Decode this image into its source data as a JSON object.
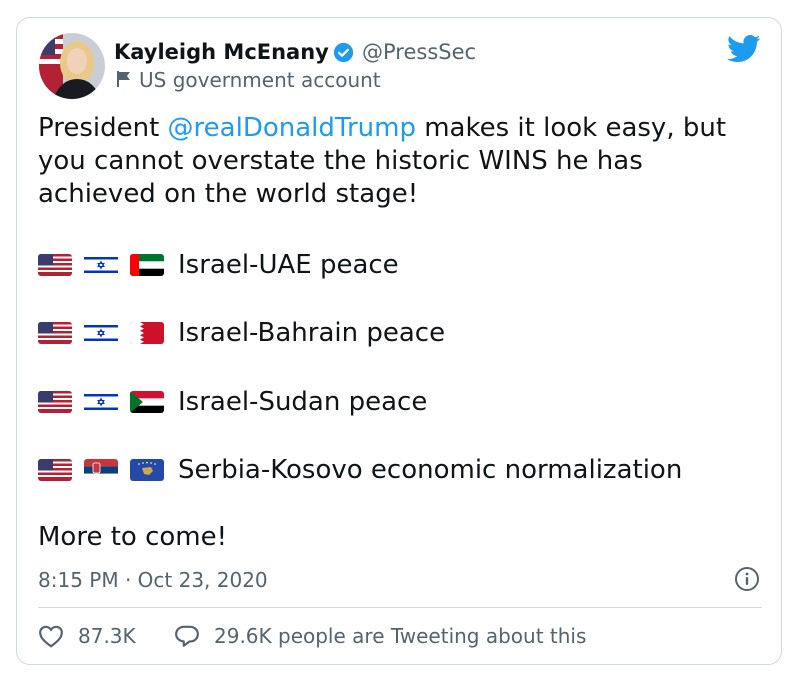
{
  "author": {
    "name": "Kayleigh McEnany",
    "handle": "@PressSec",
    "label": "US government account"
  },
  "tweet": {
    "intro_before_mention": "President ",
    "mention": "@realDonaldTrump",
    "intro_after_mention": " makes it look easy, but you cannot overstate the historic WINS he has achieved on the world stage!",
    "lines": [
      {
        "flags": [
          "us",
          "israel",
          "uae"
        ],
        "text": "Israel-UAE peace"
      },
      {
        "flags": [
          "us",
          "israel",
          "bahrain"
        ],
        "text": "Israel-Bahrain peace"
      },
      {
        "flags": [
          "us",
          "israel",
          "sudan"
        ],
        "text": "Israel-Sudan peace"
      },
      {
        "flags": [
          "us",
          "serbia",
          "kosovo"
        ],
        "text": "Serbia-Kosovo economic normalization"
      }
    ],
    "closing": "More to come!",
    "timestamp": "8:15 PM · Oct 23, 2020"
  },
  "engagement": {
    "likes": "87.3K",
    "tweeting": "29.6K people are Tweeting about this"
  },
  "colors": {
    "accent": "#1d9bf0",
    "muted": "#536471",
    "border": "#cfd9de"
  },
  "icons": [
    "avatar-photo",
    "verified-badge-icon",
    "government-flag-icon",
    "twitter-bird-icon",
    "info-icon",
    "heart-icon",
    "reply-bubble-icon"
  ]
}
